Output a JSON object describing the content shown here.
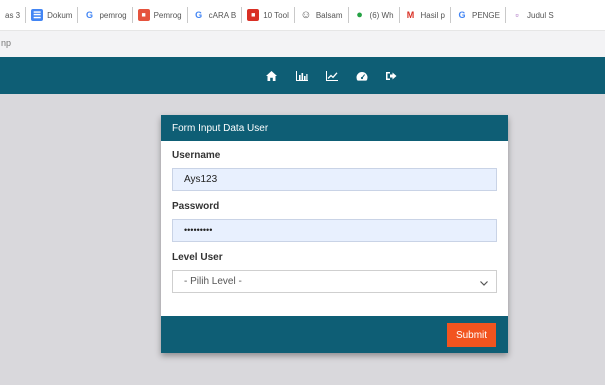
{
  "bookmarks": [
    {
      "icon": "folder-icon",
      "label": "as 3",
      "fav_char": "",
      "fav_bg": "transparent",
      "fav_fg": "#555"
    },
    {
      "icon": "docs-icon",
      "label": "Dokum",
      "fav_char": "☰",
      "fav_bg": "#4285f4",
      "fav_fg": "#fff"
    },
    {
      "icon": "google-icon",
      "label": "pemrog",
      "fav_char": "G",
      "fav_bg": "transparent",
      "fav_fg": "#4285f4"
    },
    {
      "icon": "site-icon",
      "label": "Pemrog",
      "fav_char": "■",
      "fav_bg": "#e5533d",
      "fav_fg": "#fff"
    },
    {
      "icon": "google-icon",
      "label": "cARA B",
      "fav_char": "G",
      "fav_bg": "transparent",
      "fav_fg": "#4285f4"
    },
    {
      "icon": "site-icon",
      "label": "10 Tool",
      "fav_char": "■",
      "fav_bg": "#d93025",
      "fav_fg": "#fff"
    },
    {
      "icon": "smiley-icon",
      "label": "Balsam",
      "fav_char": "☺",
      "fav_bg": "transparent",
      "fav_fg": "#555"
    },
    {
      "icon": "whatsapp-icon",
      "label": "(6) Wh",
      "fav_char": "●",
      "fav_bg": "transparent",
      "fav_fg": "#25a244"
    },
    {
      "icon": "gmail-icon",
      "label": "Hasil p",
      "fav_char": "M",
      "fav_bg": "transparent",
      "fav_fg": "#d93025"
    },
    {
      "icon": "google-icon",
      "label": "PENGE",
      "fav_char": "G",
      "fav_bg": "transparent",
      "fav_fg": "#4285f4"
    },
    {
      "icon": "site-icon",
      "label": "Judul S",
      "fav_char": "▫",
      "fav_bg": "transparent",
      "fav_fg": "#8e44ad"
    }
  ],
  "strip_text": "np",
  "nav": {
    "icons": [
      "home-icon",
      "bar-chart-icon",
      "line-chart-icon",
      "dashboard-icon",
      "logout-icon"
    ]
  },
  "form": {
    "title": "Form Input Data User",
    "username_label": "Username",
    "username_value": "Ays123",
    "password_label": "Password",
    "password_value": "•••••••••",
    "level_label": "Level User",
    "level_selected": "- Pilih Level -",
    "submit_label": "Submit"
  },
  "colors": {
    "primary": "#0e5e75",
    "accent": "#f2541f",
    "input_autofill": "#e8f0fe",
    "page_bg": "#d9d8dc"
  }
}
